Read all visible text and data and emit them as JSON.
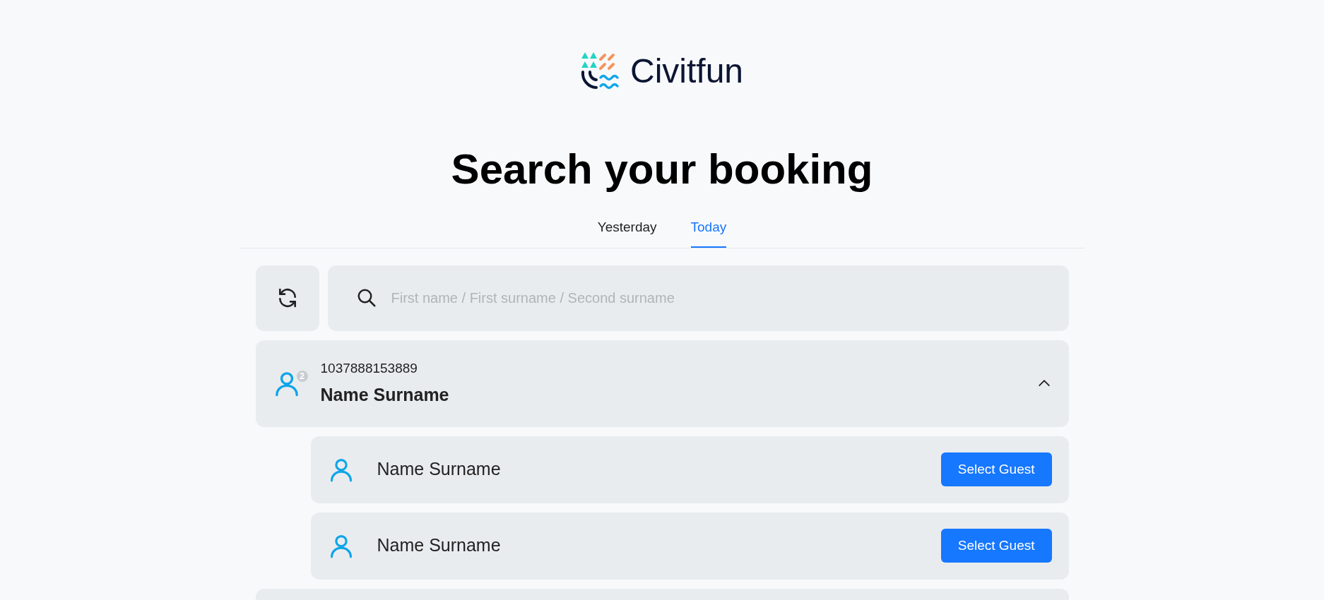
{
  "logo": {
    "text": "Civitfun"
  },
  "title": "Search your booking",
  "tabs": [
    {
      "label": "Yesterday",
      "selected": false
    },
    {
      "label": "Today",
      "selected": true
    }
  ],
  "search": {
    "placeholder": "First name / First surname / Second surname"
  },
  "bookings": [
    {
      "number": "1037888153889",
      "name": "Name Surname",
      "guest_count": "2",
      "expanded": true,
      "guests": [
        {
          "name": "Name Surname",
          "button": "Select Guest"
        },
        {
          "name": "Name Surname",
          "button": "Select Guest"
        }
      ]
    }
  ]
}
